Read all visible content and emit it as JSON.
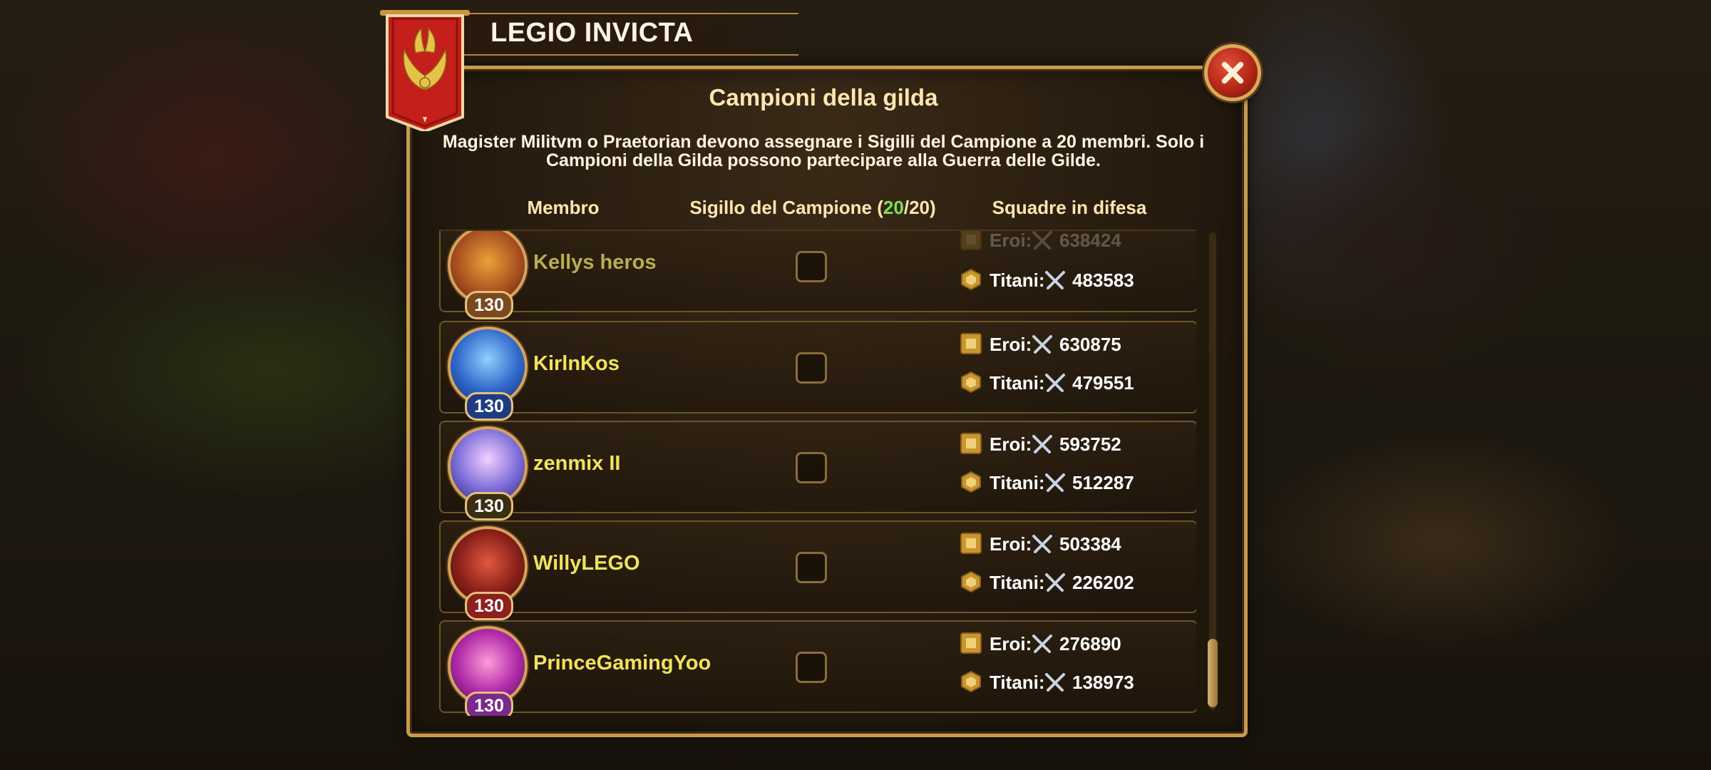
{
  "header": {
    "guild_name": "LEGIO INVICTA"
  },
  "dialog": {
    "heading": "Campioni della gilda",
    "description": "Magister Militvm o Praetorian devono assegnare i Sigilli del Campione a 20 membri. Solo i Campioni della Gilda possono partecipare alla Guerra delle Gilde.",
    "columns": {
      "member": "Membro",
      "seal_label": "Sigillo del Campione",
      "seal_open": "(",
      "seal_assigned": "20",
      "seal_sep": "/",
      "seal_total": "20",
      "seal_close": ")",
      "defense": "Squadre in difesa"
    }
  },
  "labels": {
    "heroes": "Eroi:",
    "titans": "Titani:"
  },
  "members": [
    {
      "name": "Kellys heros",
      "level": "130",
      "heroes": "638424",
      "titans": "483583",
      "checked": false
    },
    {
      "name": "KirlnKos",
      "level": "130",
      "heroes": "630875",
      "titans": "479551",
      "checked": false
    },
    {
      "name": "zenmix II",
      "level": "130",
      "heroes": "593752",
      "titans": "512287",
      "checked": false
    },
    {
      "name": "WillyLEGO",
      "level": "130",
      "heroes": "503384",
      "titans": "226202",
      "checked": false
    },
    {
      "name": "PrinceGamingYoo",
      "level": "130",
      "heroes": "276890",
      "titans": "138973",
      "checked": false
    }
  ],
  "colors": {
    "accent_gold": "#c79a4d",
    "name_yellow": "#f0e35c",
    "count_green": "#7be05a",
    "close_red": "#b32616"
  }
}
